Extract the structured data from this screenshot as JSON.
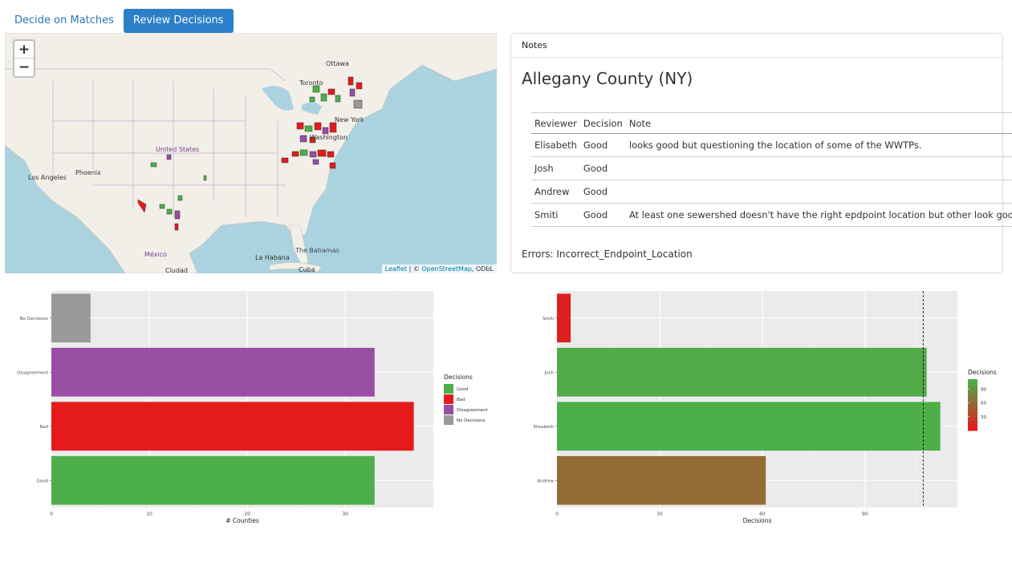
{
  "tabs": [
    "Decide on Matches",
    "Review Decisions"
  ],
  "map": {
    "zoom_in": "+",
    "zoom_out": "−",
    "places": [
      "Ottawa",
      "Toronto",
      "New York",
      "Washington",
      "United States",
      "Phoenix",
      "Los Angeles",
      "México",
      "La Habana",
      "The Bahamas",
      "Ciudad",
      "Cuba"
    ],
    "attribution_leaflet": "Leaflet",
    "attribution_sep": " | © ",
    "attribution_osm": "OpenStreetMap",
    "attribution_odbl": ", ODbL"
  },
  "notes": {
    "header": "Notes",
    "county": "Allegany County (NY)",
    "columns": [
      "Reviewer",
      "Decision",
      "Note"
    ],
    "rows": [
      [
        "Elisabeth",
        "Good",
        "looks good but questioning the location of some of the WWTPs."
      ],
      [
        "Josh",
        "Good",
        ""
      ],
      [
        "Andrew",
        "Good",
        ""
      ],
      [
        "Smiti",
        "Good",
        "At least one sewershed doesn't have the right epdpoint location but other look good"
      ]
    ],
    "errors": "Errors: Incorrect_Endpoint_Location"
  },
  "colors": {
    "good": "#4daf4a",
    "bad": "#e41a1c",
    "disagreement": "#984ea3",
    "none": "#999999",
    "panel": "#ebebeb"
  },
  "chart_data": [
    {
      "type": "bar",
      "orientation": "horizontal",
      "categories": [
        "Good",
        "Bad",
        "Disagreement",
        "No Decisions"
      ],
      "values": [
        33,
        37,
        33,
        4
      ],
      "xlabel": "# Counties",
      "ylabel": "",
      "xlim": [
        0,
        39
      ],
      "xticks": [
        0,
        10,
        20,
        30
      ],
      "legend_title": "Decisions",
      "legend": [
        "Good",
        "Bad",
        "Disagreement",
        "No Decisions"
      ],
      "legend_position": "right",
      "grid": true
    },
    {
      "type": "bar",
      "orientation": "horizontal",
      "categories": [
        "Andrew",
        "Elisabeth",
        "Josh",
        "Smiti"
      ],
      "values": [
        61,
        112,
        108,
        4
      ],
      "xlabel": "Decisions",
      "ylabel": "",
      "xlim": [
        0,
        117
      ],
      "xticks": [
        0,
        30,
        60,
        90
      ],
      "reference_line": 107,
      "legend_title": "Decisions",
      "legend_ticks": [
        30,
        60,
        90
      ],
      "color_scale": [
        "#e41a1c",
        "#4daf4a"
      ],
      "legend_position": "right",
      "grid": true
    }
  ]
}
